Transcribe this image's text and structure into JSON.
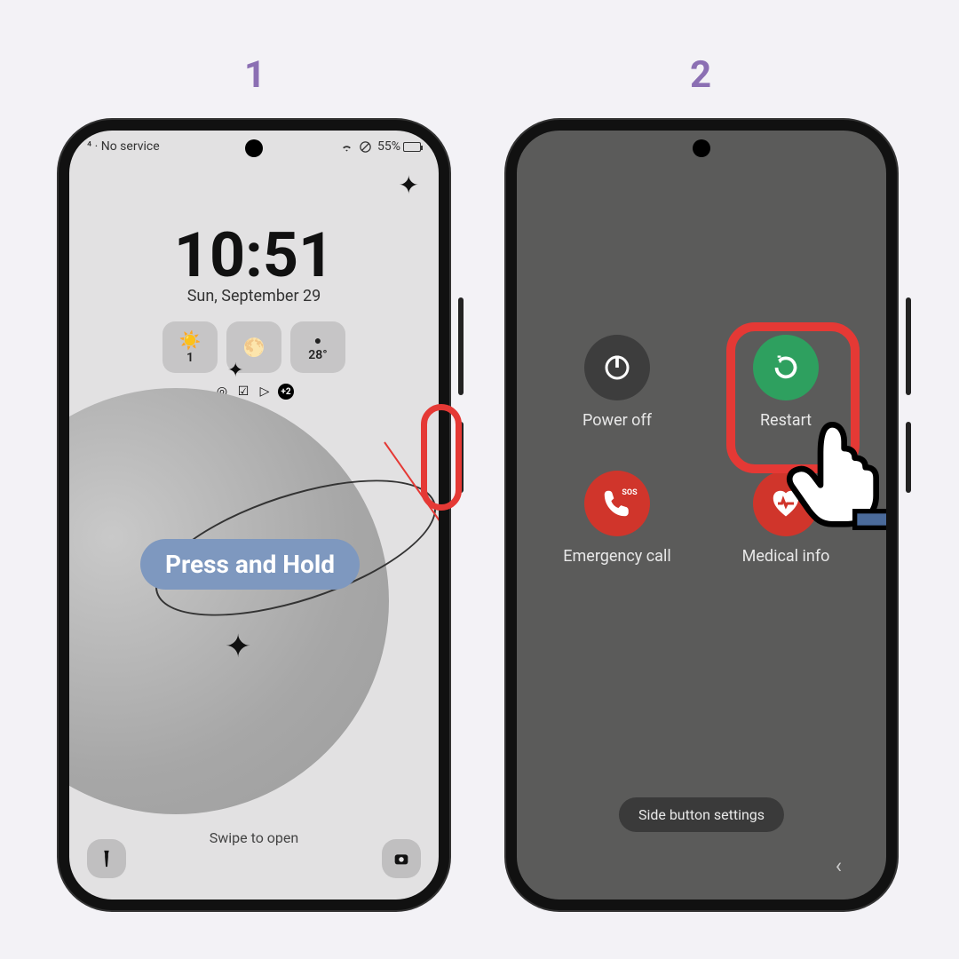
{
  "step1_number": "1",
  "step2_number": "2",
  "callout_label": "Press and Hold",
  "phone1": {
    "status_left": "⁴ · No service",
    "battery_percent": "55%",
    "clock_time": "10:51",
    "clock_date": "Sun, September 29",
    "widget_alerts": "1",
    "widget_temp": "28°",
    "icon_badge": "+2",
    "swipe_hint": "Swipe to open"
  },
  "phone2": {
    "power_off": "Power off",
    "restart": "Restart",
    "emergency_call": "Emergency call",
    "medical_info": "Medical info",
    "side_button_settings": "Side button settings"
  }
}
